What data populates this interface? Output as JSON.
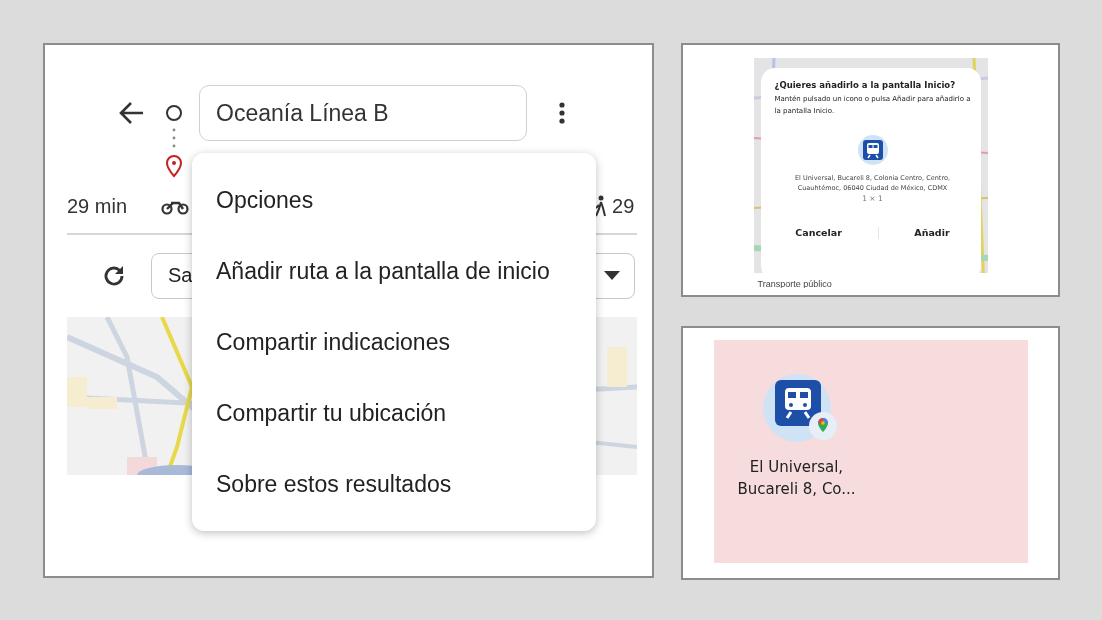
{
  "maps_screen": {
    "search": {
      "value": "Oceanía Línea B"
    },
    "travel_modes": [
      {
        "kind": "plain",
        "time": "29 min"
      },
      {
        "kind": "motorcycle"
      },
      {
        "kind": "walk",
        "time": "29"
      }
    ],
    "departure": {
      "value": "Sa"
    },
    "menu": {
      "title": "Opciones",
      "items": [
        "Añadir ruta a la pantalla de inicio",
        "Compartir indicaciones",
        "Compartir tu ubicación",
        "Sobre estos resultados"
      ]
    }
  },
  "add_dialog": {
    "title": "¿Quieres añadirlo a la pantalla Inicio?",
    "message": "Mantén pulsado un icono o pulsa Añadir para añadirlo a la pantalla Inicio.",
    "address": "El Universal, Bucareli 8, Colonia Centro, Centro, Cuauhtémoc, 06040 Ciudad de México, CDMX",
    "size": "1 × 1",
    "buttons": [
      "Cancelar",
      "Añadir"
    ],
    "below_text": "Transporte público"
  },
  "home_screen": {
    "shortcut": {
      "label": "El Universal, Bucareli 8, Co..."
    }
  }
}
